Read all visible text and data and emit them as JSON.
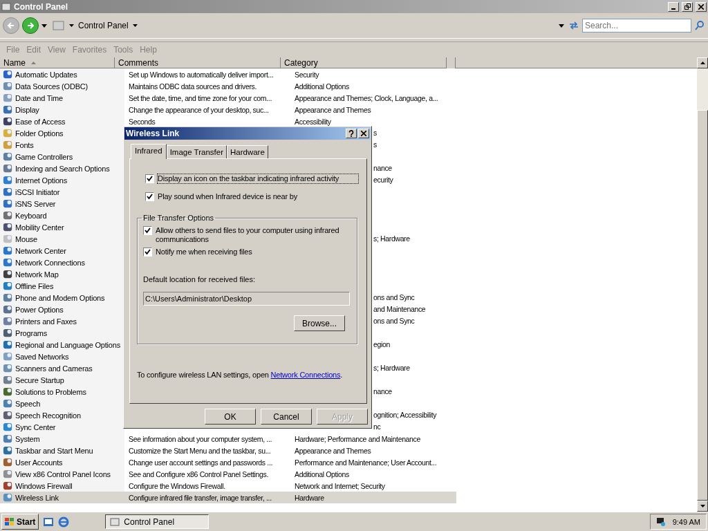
{
  "window": {
    "title": "Control Panel"
  },
  "toolbar": {
    "address": "Control Panel",
    "search": {
      "placeholder": "Search..."
    }
  },
  "menu": [
    {
      "label": "File"
    },
    {
      "label": "Edit"
    },
    {
      "label": "View"
    },
    {
      "label": "Favorites"
    },
    {
      "label": "Tools"
    },
    {
      "label": "Help"
    }
  ],
  "columns": [
    {
      "label": "Name",
      "sorted": true
    },
    {
      "label": "Comments",
      "sorted": false
    },
    {
      "label": "Category",
      "sorted": false
    }
  ],
  "rows": [
    {
      "name": "Automatic Updates",
      "comments": "Set up Windows to automatically deliver import...",
      "category": "Security",
      "selected": false
    },
    {
      "name": "Data Sources (ODBC)",
      "comments": "Maintains ODBC data sources and drivers.",
      "category": "Additional Options",
      "selected": false
    },
    {
      "name": "Date and Time",
      "comments": "Set the date, time, and time zone for your com...",
      "category": "Appearance and Themes; Clock, Language, a...",
      "selected": false
    },
    {
      "name": "Display",
      "comments": "Change the appearance of your desktop, suc...",
      "category": "Appearance and Themes",
      "selected": false
    },
    {
      "name": "Ease of Access",
      "comments": "Seconds",
      "category": "Accessibility",
      "selected": false
    },
    {
      "name": "Folder Options",
      "category_tail": "s",
      "selected": false
    },
    {
      "name": "Fonts",
      "category_tail": "s",
      "selected": false
    },
    {
      "name": "Game Controllers",
      "selected": false
    },
    {
      "name": "Indexing and Search Options",
      "category_tail": "nance",
      "selected": false
    },
    {
      "name": "Internet Options",
      "category_tail": "ecurity",
      "selected": false
    },
    {
      "name": "iSCSI Initiator",
      "selected": false
    },
    {
      "name": "iSNS Server",
      "selected": false
    },
    {
      "name": "Keyboard",
      "selected": false
    },
    {
      "name": "Mobility Center",
      "selected": false
    },
    {
      "name": "Mouse",
      "category_tail": "s; Hardware",
      "selected": false
    },
    {
      "name": "Network Center",
      "selected": false
    },
    {
      "name": "Network Connections",
      "selected": false
    },
    {
      "name": "Network Map",
      "selected": false
    },
    {
      "name": "Offline Files",
      "selected": false
    },
    {
      "name": "Phone and Modem Options",
      "category_tail": "ons and Sync",
      "selected": false
    },
    {
      "name": "Power Options",
      "category_tail": "and Maintenance",
      "selected": false
    },
    {
      "name": "Printers and Faxes",
      "category_tail": "ons and Sync",
      "selected": false
    },
    {
      "name": "Programs",
      "selected": false
    },
    {
      "name": "Regional and Language Options",
      "category_tail": "egion",
      "selected": false
    },
    {
      "name": "Saved Networks",
      "selected": false
    },
    {
      "name": "Scanners and Cameras",
      "category_tail": "s; Hardware",
      "selected": false
    },
    {
      "name": "Secure Startup",
      "selected": false
    },
    {
      "name": "Solutions to Problems",
      "category_tail": "nance",
      "selected": false
    },
    {
      "name": "Speech",
      "selected": false
    },
    {
      "name": "Speech Recognition",
      "category_tail": "ognition; Accessibility",
      "selected": false
    },
    {
      "name": "Sync Center",
      "category_tail": "nc",
      "selected": false
    },
    {
      "name": "System",
      "comments": "See information about your computer system, ...",
      "category": "Hardware; Performance and Maintenance",
      "selected": false
    },
    {
      "name": "Taskbar and Start Menu",
      "comments": "Customize the Start Menu and the taskbar, su...",
      "category": "Appearance and Themes",
      "selected": false
    },
    {
      "name": "User Accounts",
      "comments": "Change user account settings and passwords ...",
      "category": "Performance and Maintenance; User Account...",
      "selected": false
    },
    {
      "name": "View x86 Control Panel Icons",
      "comments": "See and Configure x86 Control Panel Settings.",
      "category": "Additional Options",
      "selected": false
    },
    {
      "name": "Windows Firewall",
      "comments": "Configure the Windows Firewall.",
      "category": "Network and Internet; Security",
      "selected": false
    },
    {
      "name": "Wireless Link",
      "comments": "Configure infrared file transfer, image transfer, ...",
      "category": "Hardware",
      "selected": true
    }
  ],
  "dialog": {
    "title": "Wireless Link",
    "tabs": [
      {
        "label": "Infrared",
        "selected": true
      },
      {
        "label": "Image Transfer",
        "selected": false
      },
      {
        "label": "Hardware",
        "selected": false
      }
    ],
    "options": [
      {
        "label": "Display an icon on the taskbar indicating infrared activity",
        "checked": true,
        "focused": true
      },
      {
        "label": "Play sound when Infrared device is near by",
        "checked": true,
        "focused": false
      }
    ],
    "group": {
      "title": "File Transfer Options",
      "options": [
        {
          "label": "Allow others to send files to your computer using infrared communications",
          "checked": true,
          "focused": false
        },
        {
          "label": "Notify me when receiving files",
          "checked": true,
          "focused": false
        }
      ],
      "field_label": "Default location for received files:",
      "field_value": "C:\\Users\\Administrator\\Desktop",
      "browse": "Browse..."
    },
    "note": {
      "text": "To configure wireless LAN settings, open ",
      "link": "Network Connections",
      "after": "."
    },
    "buttons": [
      {
        "label": "OK",
        "disabled": false
      },
      {
        "label": "Cancel",
        "disabled": false
      },
      {
        "label": "Apply",
        "disabled": true
      }
    ]
  },
  "taskbar": {
    "start": "Start",
    "tasks": [
      {
        "label": "Control Panel",
        "selected": true
      }
    ],
    "clock": "9:49 AM"
  }
}
